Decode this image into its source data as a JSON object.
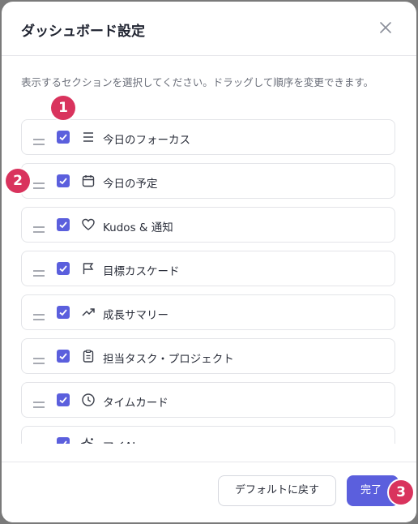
{
  "dialog": {
    "title": "ダッシュボード設定",
    "description": "表示するセクションを選択してください。ドラッグして順序を変更できます。"
  },
  "sections": [
    {
      "label": "今日のフォーカス",
      "checked": true,
      "icon": "list-icon"
    },
    {
      "label": "今日の予定",
      "checked": true,
      "icon": "calendar-icon"
    },
    {
      "label": "Kudos & 通知",
      "checked": true,
      "icon": "heart-icon"
    },
    {
      "label": "目標カスケード",
      "checked": true,
      "icon": "flag-icon"
    },
    {
      "label": "成長サマリー",
      "checked": true,
      "icon": "trending-up-icon"
    },
    {
      "label": "担当タスク・プロジェクト",
      "checked": true,
      "icon": "clipboard-icon"
    },
    {
      "label": "タイムカード",
      "checked": true,
      "icon": "clock-icon"
    },
    {
      "label": "マイAI",
      "checked": true,
      "icon": "sparkle-icon"
    }
  ],
  "footer": {
    "reset_label": "デフォルトに戻す",
    "done_label": "完了"
  },
  "badges": [
    "1",
    "2",
    "3"
  ],
  "colors": {
    "accent": "#5b5fdd",
    "badge": "#d9335d",
    "border": "#e3e4e8"
  }
}
